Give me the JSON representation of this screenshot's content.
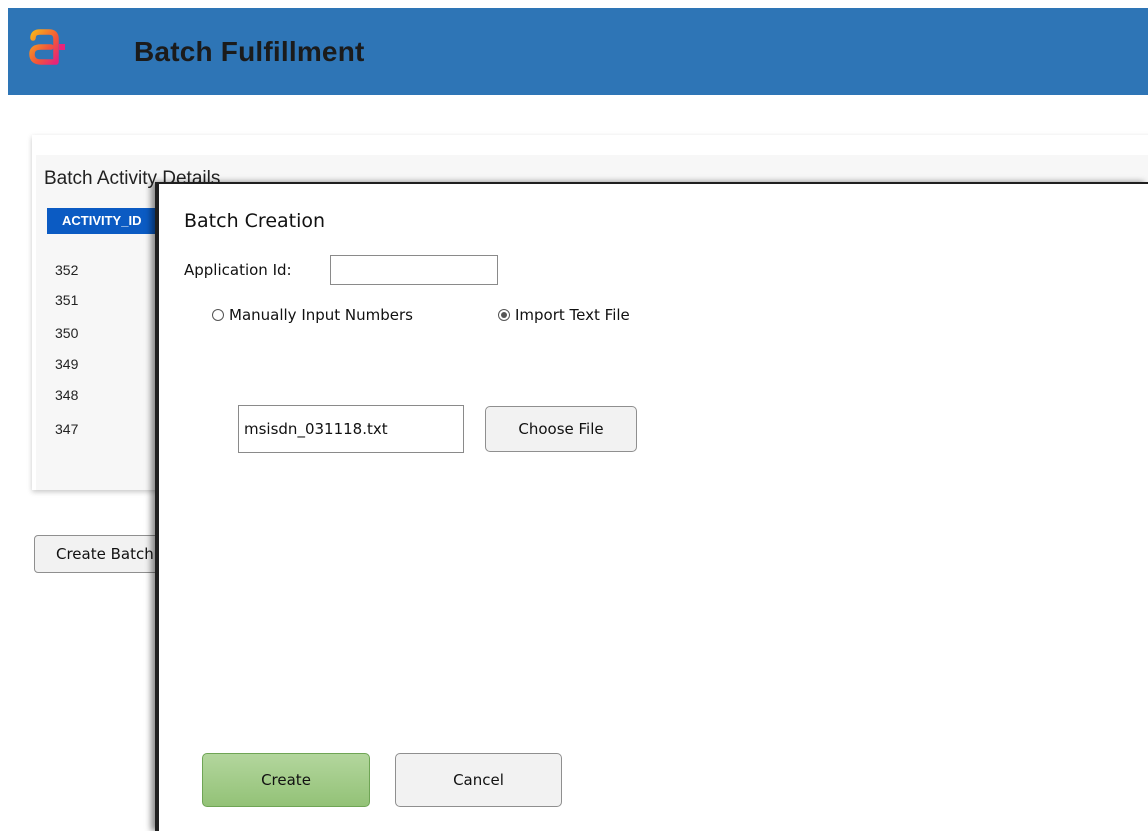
{
  "header": {
    "title": "Batch Fulfillment",
    "logo": "amdocs-logo",
    "background_color": "#2e75b6"
  },
  "background_page": {
    "card_title": "Batch Activity Details",
    "column_header": "ACTIVITY_ID",
    "column_header_color": "#0b5bc3",
    "rows": [
      "352",
      "351",
      "350",
      "349",
      "348",
      "347"
    ],
    "create_batch_button": "Create Batch"
  },
  "modal": {
    "title": "Batch Creation",
    "application_id_label": "Application Id:",
    "application_id_value": "",
    "radio_manual_label": "Manually Input Numbers",
    "radio_import_label": "Import Text File",
    "selected_mode": "Import Text File",
    "file_name": "msisdn_031118.txt",
    "choose_file_label": "Choose File",
    "create_label": "Create",
    "cancel_label": "Cancel",
    "create_button_color": "#9cc97f"
  }
}
